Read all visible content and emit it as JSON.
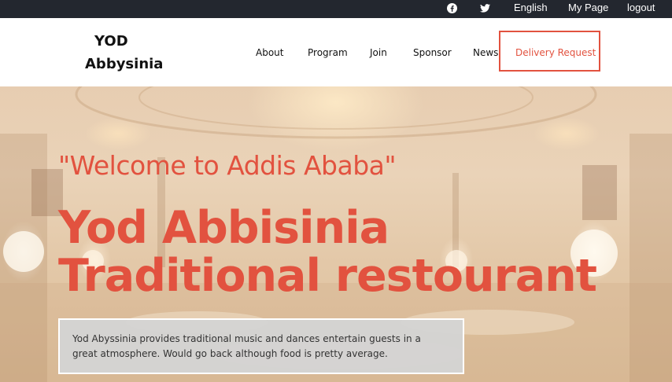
{
  "topbar": {
    "icons": [
      "facebook-icon",
      "twitter-icon"
    ],
    "language": "English",
    "my_page": "My Page",
    "logout": "logout"
  },
  "header": {
    "logo_line1": "YOD",
    "logo_line2": "Abbysinia",
    "nav": {
      "about": "About",
      "program": "Program",
      "join": "Join",
      "sponsor": "Sponsor",
      "news": "News",
      "delivery": "Delivery Request"
    }
  },
  "hero": {
    "subtitle": "\"Welcome to Addis Ababa\"",
    "title": "Yod Abbisinia Traditional restourant",
    "description": "Yod Abyssinia provides traditional music and dances entertain guests in a great atmosphere. Would go back although food is pretty average."
  },
  "colors": {
    "accent": "#e2523f",
    "topbar_bg": "#23272f",
    "box_bg": "#d4d4d4"
  }
}
